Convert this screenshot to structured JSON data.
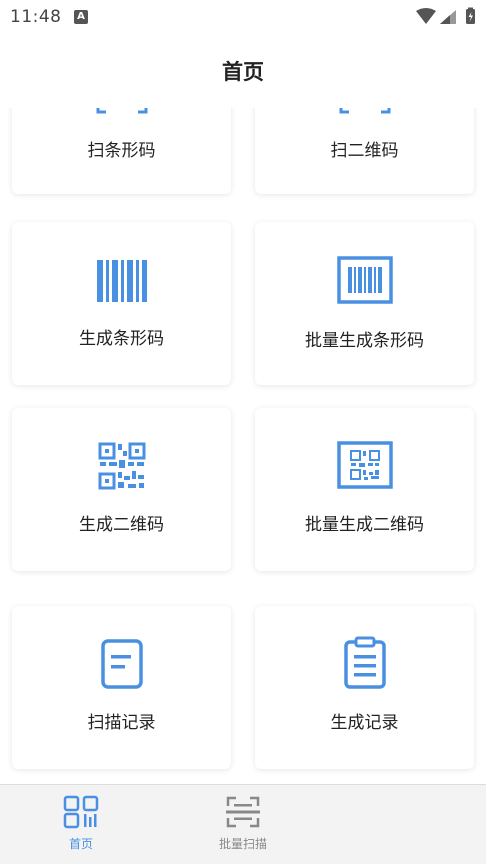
{
  "status_bar": {
    "time": "11:48",
    "indicator": "A"
  },
  "header": {
    "title": "首页"
  },
  "cards": [
    {
      "label": "扫条形码",
      "icon": "scan-frame-icon"
    },
    {
      "label": "扫二维码",
      "icon": "scan-frame-icon"
    },
    {
      "label": "生成条形码",
      "icon": "barcode-icon"
    },
    {
      "label": "批量生成条形码",
      "icon": "framed-barcode-icon"
    },
    {
      "label": "生成二维码",
      "icon": "qrcode-icon"
    },
    {
      "label": "批量生成二维码",
      "icon": "framed-qrcode-icon"
    },
    {
      "label": "扫描记录",
      "icon": "document-icon"
    },
    {
      "label": "生成记录",
      "icon": "clipboard-icon"
    }
  ],
  "tab_bar": {
    "tabs": [
      {
        "label": "首页",
        "active": true
      },
      {
        "label": "批量扫描",
        "active": false
      }
    ]
  },
  "colors": {
    "accent": "#4a90e2",
    "inactive": "#888888"
  }
}
